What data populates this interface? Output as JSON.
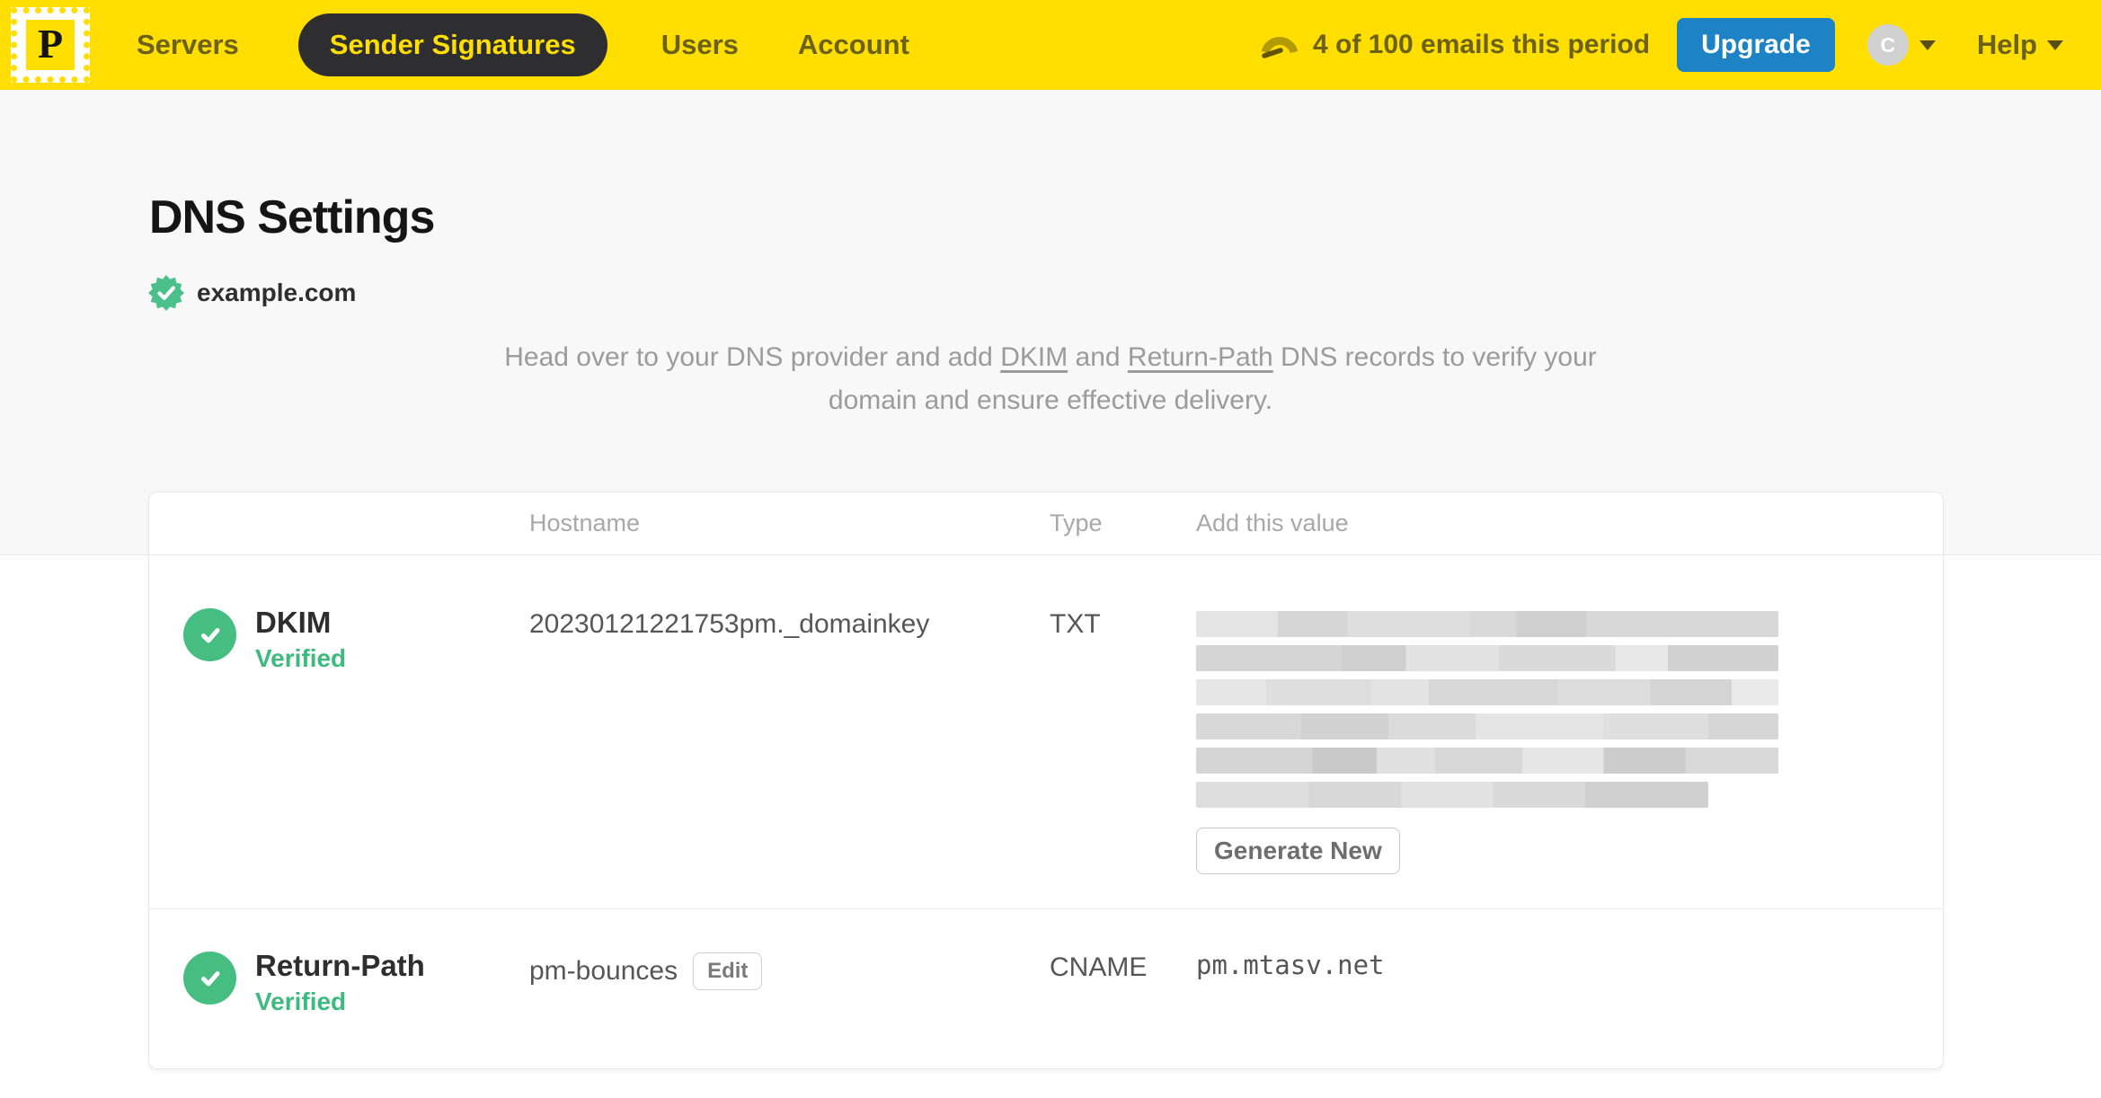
{
  "header": {
    "logo_letter": "P",
    "nav": {
      "servers": "Servers",
      "sender_signatures": "Sender Signatures",
      "users": "Users",
      "account": "Account"
    },
    "usage_text": "4 of 100 emails this period",
    "upgrade_label": "Upgrade",
    "avatar_initial": "C",
    "help_label": "Help"
  },
  "page": {
    "title": "DNS Settings",
    "domain": "example.com",
    "description": {
      "intro": "Head over to your DNS provider and add ",
      "link_dkim": "DKIM",
      "mid": " and ",
      "link_return_path": "Return-Path",
      "outro": " DNS records to verify your domain and ensure effective delivery."
    }
  },
  "table": {
    "headers": {
      "hostname": "Hostname",
      "type": "Type",
      "value": "Add this value"
    },
    "rows": [
      {
        "name": "DKIM",
        "status": "Verified",
        "hostname": "20230121221753pm._domainkey",
        "type": "TXT",
        "value_redacted": true,
        "action_label": "Generate New"
      },
      {
        "name": "Return-Path",
        "status": "Verified",
        "hostname": "pm-bounces",
        "edit_label": "Edit",
        "type": "CNAME",
        "value": "pm.mtasv.net"
      }
    ]
  },
  "colors": {
    "brand_yellow": "#ffde00",
    "nav_text_olive": "#6b6118",
    "active_pill_bg": "#2e2e30",
    "upgrade_blue": "#1d83c5",
    "verified_green": "#46be82",
    "verified_text_green": "#3dba7d"
  }
}
